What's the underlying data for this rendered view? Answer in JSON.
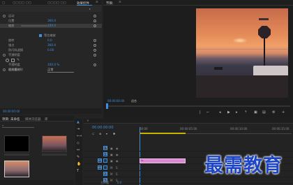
{
  "effect_controls": {
    "tabs": [
      "",
      "效果控件",
      "",
      ""
    ],
    "header_clip": "",
    "rows": [
      {
        "label": "运动",
        "value": ""
      },
      {
        "label": "位置",
        "value": "360.0"
      },
      {
        "label": "缩放",
        "value": "100.0"
      },
      {
        "label": "",
        "value": ""
      },
      {
        "label": "",
        "value": "等比缩放"
      },
      {
        "label": "旋转",
        "value": "0.0"
      },
      {
        "label": "锚点",
        "value": "360.0"
      },
      {
        "label": "防闪烁滤镜",
        "value": "0.00"
      },
      {
        "label": "不透明度",
        "value": ""
      },
      {
        "label": "",
        "value": ""
      },
      {
        "label": "不透明度",
        "value": "100.0 %"
      },
      {
        "label": "混合模式",
        "value": "正常"
      },
      {
        "label": "时间重映射",
        "value": ""
      }
    ],
    "timecode": "00:00:00:00"
  },
  "program": {
    "tab": "节目: ",
    "fit": "适合",
    "timecode": "00:00:00:00"
  },
  "project": {
    "tabs": [
      "项目: 未命名",
      "媒体浏览器",
      "库"
    ],
    "search_placeholder": "",
    "item_count": ""
  },
  "timeline": {
    "timecode": "00:00:00:00",
    "ruler": [
      "00:00",
      "00:00:05:00",
      "00:00:10:00",
      "00:00:15:00"
    ],
    "tracks_video": [
      "V3",
      "V2",
      "V1"
    ],
    "tracks_audio": [
      "A1",
      "A2",
      "A3"
    ],
    "master": "主声道",
    "master_value": "0.0",
    "clip_label": "fx"
  },
  "watermark": "最需教育"
}
